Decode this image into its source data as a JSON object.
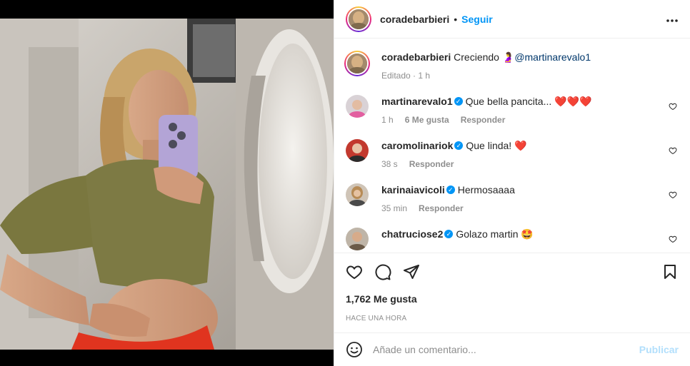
{
  "post": {
    "author": "coradebarbieri",
    "follow_label": "Seguir",
    "separator": "•",
    "more_label": "•••",
    "caption": {
      "username": "coradebarbieri",
      "text": "Creciendo",
      "emoji": "🤰",
      "mention": "@martinarevalo1",
      "time": "Editado · 1 h"
    },
    "comments": [
      {
        "username": "martinarevalo1",
        "verified": true,
        "text": "Que bella pancita... ❤️❤️❤️",
        "time": "1 h",
        "likes": "6 Me gusta",
        "reply": "Responder"
      },
      {
        "username": "caromolinariok",
        "verified": true,
        "text": "Que linda! ❤️",
        "time": "38 s",
        "reply": "Responder"
      },
      {
        "username": "karinaiavicoli",
        "verified": true,
        "text": "Hermosaaaa",
        "time": "35 min",
        "reply": "Responder"
      },
      {
        "username": "chatruciose2",
        "verified": true,
        "text": "Golazo martin 🤩",
        "time": "",
        "reply": ""
      }
    ],
    "likes_count": "1,762 Me gusta",
    "time_ago": "HACE UNA HORA",
    "add_comment": {
      "placeholder": "Añade un comentario...",
      "post_label": "Publicar"
    }
  },
  "colors": {
    "accent": "#0095f6",
    "muted": "#8e8e8e",
    "post_disabled": "#b2dffc",
    "heart": "#ed4956"
  },
  "icons": [
    "more-icon",
    "heart-icon",
    "comment-icon",
    "share-icon",
    "bookmark-icon",
    "emoji-icon",
    "verified-icon"
  ]
}
